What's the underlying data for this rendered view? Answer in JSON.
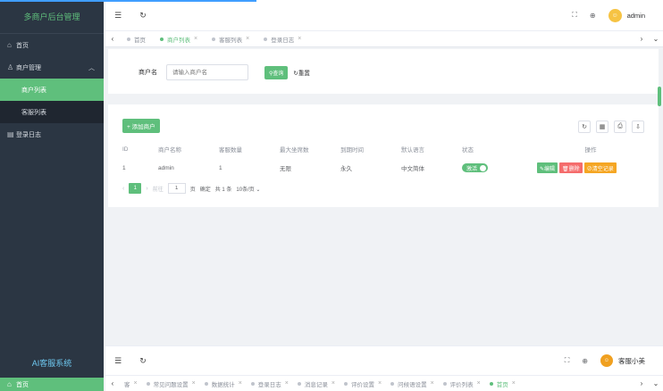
{
  "sidebar": {
    "title": "多商户后台管理",
    "items": [
      {
        "label": "首页",
        "icon": "home-icon"
      },
      {
        "label": "商户管理",
        "icon": "user-icon"
      },
      {
        "label": "登录日志",
        "icon": "calendar-icon"
      }
    ],
    "subitems": [
      {
        "label": "商户列表",
        "active": true
      },
      {
        "label": "客服列表",
        "active": false
      }
    ]
  },
  "header": {
    "username": "admin"
  },
  "tabs": [
    {
      "label": "首页",
      "active": false
    },
    {
      "label": "商户列表",
      "active": true
    },
    {
      "label": "客服列表",
      "active": false
    },
    {
      "label": "登录日志",
      "active": false
    }
  ],
  "search": {
    "label": "商户名",
    "placeholder": "请输入商户名",
    "query_label": "查询",
    "reset_label": "重置"
  },
  "table": {
    "add_label": "添加商户",
    "columns": [
      "ID",
      "商户名称",
      "客服数量",
      "最大坐席数",
      "到期时间",
      "默认语言",
      "状态",
      "操作"
    ],
    "rows": [
      {
        "id": "1",
        "name": "admin",
        "agents": "1",
        "max_seats": "无限",
        "expire": "永久",
        "language": "中文简体",
        "status": "激活"
      }
    ],
    "actions": {
      "edit": "编辑",
      "delete": "删除",
      "clear": "清空记录"
    }
  },
  "pagination": {
    "page": "1",
    "goto_label": "前往",
    "page_unit": "页",
    "confirm": "确定",
    "total": "共 1 条",
    "page_size": "10条/页"
  },
  "sidebar2": {
    "title": "AI客服系统",
    "item": "首页"
  },
  "header2": {
    "username": "客服小美"
  },
  "tabs2": [
    "客",
    "常见问题设置",
    "数据统计",
    "登录日志",
    "消息记录",
    "评价设置",
    "问候语设置",
    "评价列表",
    "首页"
  ],
  "colors": {
    "accent": "#5fbf7c",
    "sidebar": "#2b3643",
    "danger": "#f56c6c",
    "warning": "#f5a623"
  }
}
